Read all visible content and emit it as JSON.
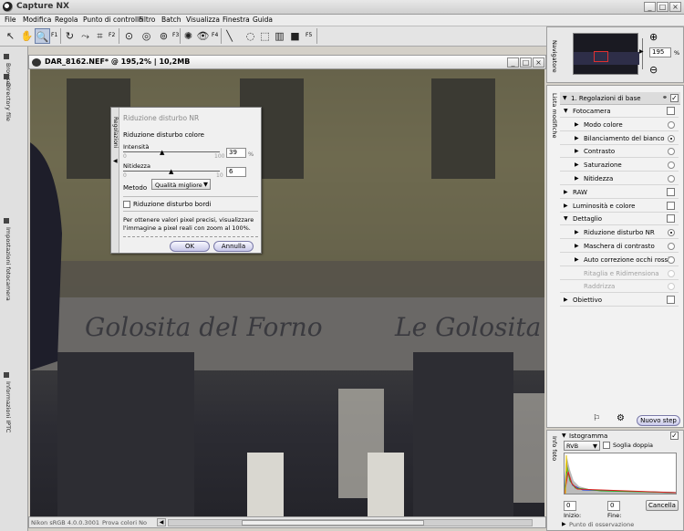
{
  "app": {
    "title": "Capture NX"
  },
  "menu": [
    "File",
    "Modifica",
    "Regola",
    "Punto di controllo",
    "Filtro",
    "Batch",
    "Visualizza",
    "Finestra",
    "Guida"
  ],
  "toolbar": {
    "labels": [
      "F1",
      "F2",
      "F3",
      "F4",
      "F5",
      "F6"
    ],
    "icons": [
      "arrow-icon",
      "hand-icon",
      "zoom-icon",
      "rotate-icon",
      "straighten-icon",
      "crop-icon",
      "black-point-icon",
      "white-point-icon",
      "neutral-point-icon",
      "color-point-icon",
      "red-eye-icon",
      "brush-icon",
      "lasso-icon",
      "marquee-icon",
      "gradient-icon",
      "fill-icon"
    ]
  },
  "left_tabs": [
    "Browser",
    "Directory file",
    "Impostazioni fotocamera",
    "Informazioni IPTC"
  ],
  "image_window": {
    "title": "DAR_8162.NEF* @ 195,2% | 10,2MB",
    "status": {
      "profile": "Nikon sRGB 4.0.0.3001",
      "proof": "Prova colori No"
    }
  },
  "dialog": {
    "title": "Riduzione disturbo NR",
    "side_label": "Regolazioni",
    "section": "Riduzione disturbo colore",
    "intensity_label": "Intensità",
    "intensity_value": "39",
    "intensity_unit": "%",
    "intensity_min": "0",
    "intensity_max": "100",
    "sharpness_label": "Nitidezza",
    "sharpness_value": "6",
    "sharpness_min": "0",
    "sharpness_max": "10",
    "method_label": "Metodo",
    "method_value": "Qualità migliore",
    "edge_label": "Riduzione disturbo bordi",
    "info_text": "Per ottenere valori pixel precisi, visualizzare l'immagine a pixel reali con zoom al 100%.",
    "ok": "OK",
    "cancel": "Annulla"
  },
  "navigator": {
    "tab": "Navigatore",
    "zoom_value": "195",
    "zoom_unit": "%"
  },
  "edit_list": {
    "tab": "Lista modifiche",
    "header": "1. Regolazioni di base",
    "rows": [
      {
        "label": "Fotocamera",
        "indent": 1,
        "type": "check",
        "expanded": true
      },
      {
        "label": "Modo colore",
        "indent": 2,
        "type": "radio"
      },
      {
        "label": "Bilanciamento del bianco",
        "indent": 2,
        "type": "radio-on"
      },
      {
        "label": "Contrasto",
        "indent": 2,
        "type": "radio"
      },
      {
        "label": "Saturazione",
        "indent": 2,
        "type": "radio"
      },
      {
        "label": "Nitidezza",
        "indent": 2,
        "type": "radio"
      },
      {
        "label": "RAW",
        "indent": 1,
        "type": "check"
      },
      {
        "label": "Luminosità e colore",
        "indent": 1,
        "type": "check"
      },
      {
        "label": "Dettaglio",
        "indent": 1,
        "type": "check",
        "expanded": true
      },
      {
        "label": "Riduzione disturbo NR",
        "indent": 2,
        "type": "radio-on"
      },
      {
        "label": "Maschera di contrasto",
        "indent": 2,
        "type": "radio"
      },
      {
        "label": "Auto correzione occhi rossi",
        "indent": 2,
        "type": "radio"
      },
      {
        "label": "Ritaglia e Ridimensiona",
        "indent": 2,
        "type": "disabled"
      },
      {
        "label": "Raddrizza",
        "indent": 2,
        "type": "disabled"
      },
      {
        "label": "Obiettivo",
        "indent": 1,
        "type": "check"
      }
    ],
    "new_step": "Nuovo step"
  },
  "histogram": {
    "tab": "Info foto",
    "title": "Istogramma",
    "channel": "RVB",
    "double_threshold": "Soglia doppia",
    "start_value": "0",
    "end_value": "0",
    "start_label": "Inizio:",
    "end_label": "Fine:",
    "cancel": "Cancella",
    "bottom_label": "Punto di osservazione"
  },
  "photo_signs": [
    "Golosita del Forno",
    "Le Golosita"
  ]
}
